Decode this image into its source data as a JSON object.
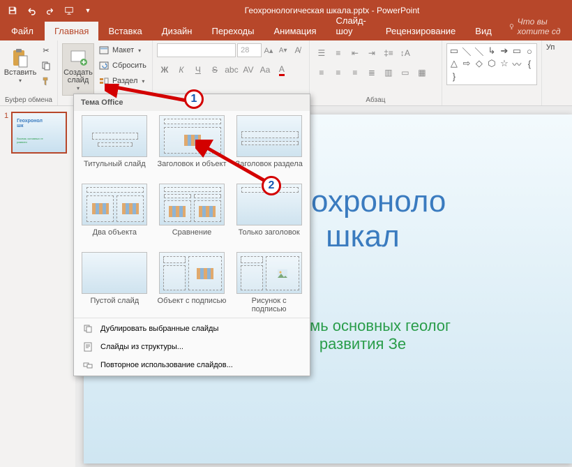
{
  "titlebar": {
    "title": "Геохронологическая шкала.pptx - PowerPoint"
  },
  "tabs": {
    "file": "Файл",
    "home": "Главная",
    "insert": "Вставка",
    "design": "Дизайн",
    "transitions": "Переходы",
    "animations": "Анимация",
    "slideshow": "Слайд-шоу",
    "review": "Рецензирование",
    "view": "Вид",
    "tell_me": "Что вы хотите сд"
  },
  "ribbon": {
    "clipboard": {
      "label": "Буфер обмена",
      "paste": "Вставить"
    },
    "slides": {
      "new_slide": "Создать слайд",
      "layout": "Макет",
      "reset": "Сбросить",
      "section": "Раздел"
    },
    "font": {
      "size": "28"
    },
    "paragraph_label": "Абзац",
    "editing_prefix": "Уп"
  },
  "gallery": {
    "header": "Тема Office",
    "layouts": [
      {
        "id": "title",
        "label": "Титульный слайд"
      },
      {
        "id": "title-content",
        "label": "Заголовок и объект"
      },
      {
        "id": "section-header",
        "label": "Заголовок раздела"
      },
      {
        "id": "two-content",
        "label": "Два объекта"
      },
      {
        "id": "comparison",
        "label": "Сравнение"
      },
      {
        "id": "title-only",
        "label": "Только заголовок"
      },
      {
        "id": "blank",
        "label": "Пустой слайд"
      },
      {
        "id": "content-caption",
        "label": "Объект с подписью"
      },
      {
        "id": "picture-caption",
        "label": "Рисунок с подписью"
      }
    ],
    "footer": {
      "duplicate": "Дублировать выбранные слайды",
      "from_outline": "Слайды из структуры...",
      "reuse": "Повторное использование слайдов..."
    }
  },
  "thumbnail": {
    "number": "1"
  },
  "slide": {
    "title_line1": "Геохроноло",
    "title_line2": "шкал",
    "sub_line1": "Восемь основных геолог",
    "sub_line2": "развития Зе",
    "thumb_title_l1": "Геохронол",
    "thumb_title_l2": "шк",
    "thumb_sub_l1": "Восемь основных ге",
    "thumb_sub_l2": "развити"
  },
  "callouts": {
    "one": "1",
    "two": "2"
  }
}
